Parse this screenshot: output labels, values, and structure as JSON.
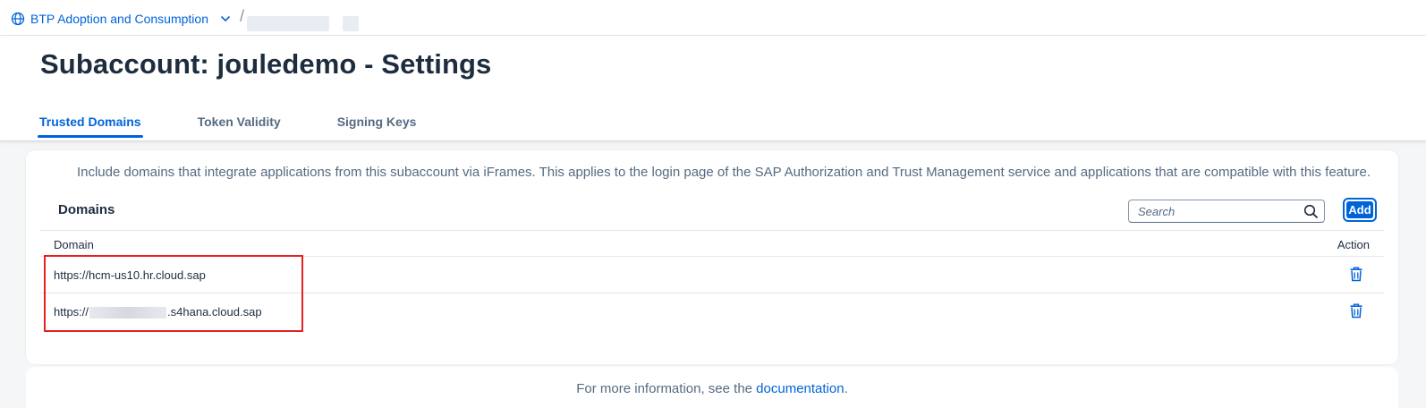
{
  "breadcrumb": {
    "global_account": "BTP Adoption and Consumption",
    "separator": "/"
  },
  "page": {
    "title": "Subaccount: jouledemo - Settings"
  },
  "tabs": [
    {
      "label": "Trusted Domains",
      "active": true
    },
    {
      "label": "Token Validity",
      "active": false
    },
    {
      "label": "Signing Keys",
      "active": false
    }
  ],
  "trusted_domains": {
    "info_text": "Include domains that integrate applications from this subaccount via iFrames. This applies to the login page of the SAP Authorization and Trust Management service and applications that are compatible with this feature.",
    "section_title": "Domains",
    "search_placeholder": "Search",
    "add_label": "Add",
    "columns": {
      "domain": "Domain",
      "action": "Action"
    },
    "rows": [
      {
        "domain": "https://hcm-us10.hr.cloud.sap"
      },
      {
        "domain_prefix": "https://",
        "domain_suffix": ".s4hana.cloud.sap"
      }
    ]
  },
  "footer": {
    "prefix": "For more information, see the ",
    "link": "documentation",
    "suffix": "."
  },
  "colors": {
    "accent": "#0064d9",
    "highlight_box": "#e52222",
    "title": "#1d2d3e"
  }
}
